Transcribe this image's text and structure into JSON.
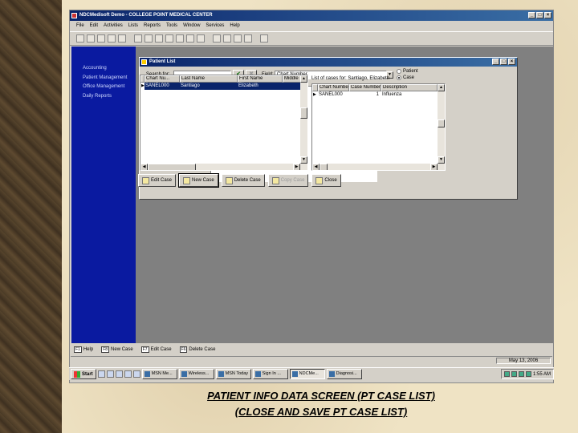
{
  "window": {
    "title": "NDCMedisoft Demo - COLLEGE POINT MEDICAL CENTER",
    "buttons": [
      "_",
      "□",
      "×"
    ]
  },
  "menu": [
    "File",
    "Edit",
    "Activities",
    "Lists",
    "Reports",
    "Tools",
    "Window",
    "Services",
    "Help"
  ],
  "sidebar": {
    "items": [
      {
        "label": "Accounting"
      },
      {
        "label": "Patient Management"
      },
      {
        "label": "Office Management"
      },
      {
        "label": "Daily Reports"
      }
    ]
  },
  "dialog": {
    "title": "Patient List",
    "search_label": "Search for:",
    "search_value": "",
    "field_label": "Field:",
    "field_value": "Chart Number",
    "radio_patient": "Patient",
    "radio_case": "Case",
    "radio_selected": "Case",
    "patient_grid": {
      "columns": [
        "Chart Nu...",
        "Last Name",
        "First Name",
        "Middle"
      ],
      "rows": [
        [
          "SANEL000",
          "Santiago",
          "Elizabeth",
          ""
        ]
      ]
    },
    "case_caption": "List of cases for: Santiago, Elizabeth",
    "case_grid": {
      "columns": [
        "Chart Number",
        "Case Number",
        "Description"
      ],
      "rows": [
        [
          "SANEL000",
          "1",
          "Influenza"
        ]
      ]
    },
    "buttons": {
      "edit_case": "Edit Case",
      "new_case": "New Case",
      "delete_case": "Delete Case",
      "copy_case": "Copy Case",
      "close": "Close"
    }
  },
  "fkeys": [
    {
      "key": "F1",
      "label": "Help"
    },
    {
      "key": "F8",
      "label": "New Case"
    },
    {
      "key": "F7",
      "label": "Edit Case"
    },
    {
      "key": "F6",
      "label": "Delete Case"
    }
  ],
  "status": {
    "date": "May 13, 2006"
  },
  "taskbar": {
    "start": "Start",
    "tasks": [
      {
        "label": "MSN Me..."
      },
      {
        "label": "Wireless..."
      },
      {
        "label": "MSN Today"
      },
      {
        "label": "Sign In ..."
      },
      {
        "label": "NDCMe..."
      },
      {
        "label": "Diagnosi..."
      }
    ],
    "active_task": "NDCMe...",
    "clock": "1:55 AM"
  },
  "caption": {
    "line1": "PATIENT INFO DATA SCREEN (PT CASE LIST)",
    "line2": "(CLOSE AND SAVE PT CASE LIST)"
  }
}
